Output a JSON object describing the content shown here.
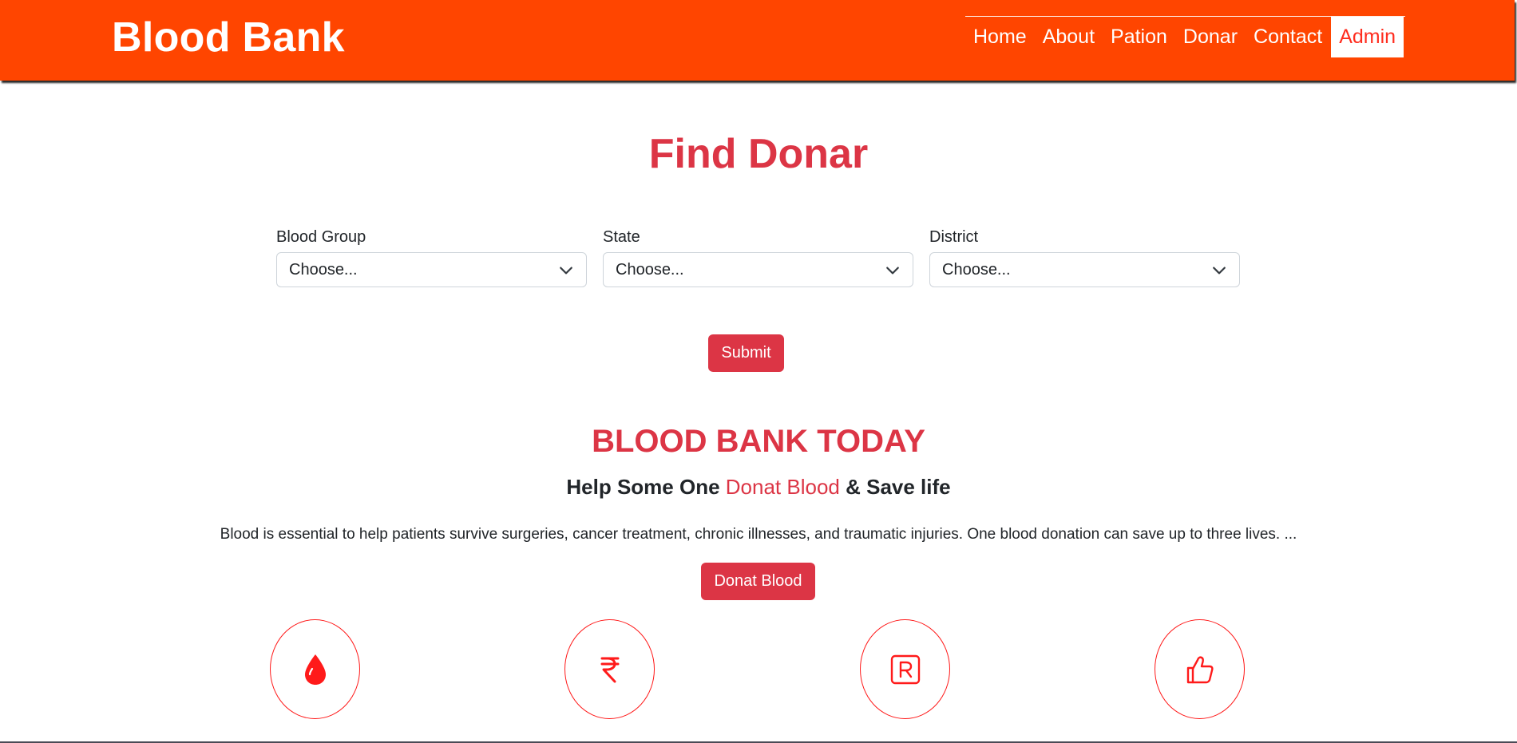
{
  "header": {
    "brand": "Blood Bank",
    "nav": [
      {
        "label": "Home"
      },
      {
        "label": "About"
      },
      {
        "label": "Pation"
      },
      {
        "label": "Donar"
      },
      {
        "label": "Contact"
      },
      {
        "label": "Admin",
        "active": true
      }
    ]
  },
  "find": {
    "title": "Find Donar",
    "fields": [
      {
        "label": "Blood Group",
        "value": "Choose..."
      },
      {
        "label": "State",
        "value": "Choose..."
      },
      {
        "label": "District",
        "value": "Choose..."
      }
    ],
    "submit_label": "Submit"
  },
  "today": {
    "title": "BLOOD BANK TODAY",
    "tagline_start": "Help Some One ",
    "tagline_highlight": "Donat Blood",
    "tagline_end": " & Save life",
    "paragraph": "Blood is essential to help patients survive surgeries, cancer treatment, chronic illnesses, and traumatic injuries. One blood donation can save up to three lives. ...",
    "cta_label": "Donat Blood"
  },
  "features": [
    {
      "icon": "blood-drop-icon"
    },
    {
      "icon": "rupee-icon"
    },
    {
      "icon": "registered-icon"
    },
    {
      "icon": "thumbs-up-icon"
    }
  ],
  "colors": {
    "header_bg": "#ff4500",
    "accent_red": "#dc3545",
    "icon_red": "#ff1a1a"
  }
}
